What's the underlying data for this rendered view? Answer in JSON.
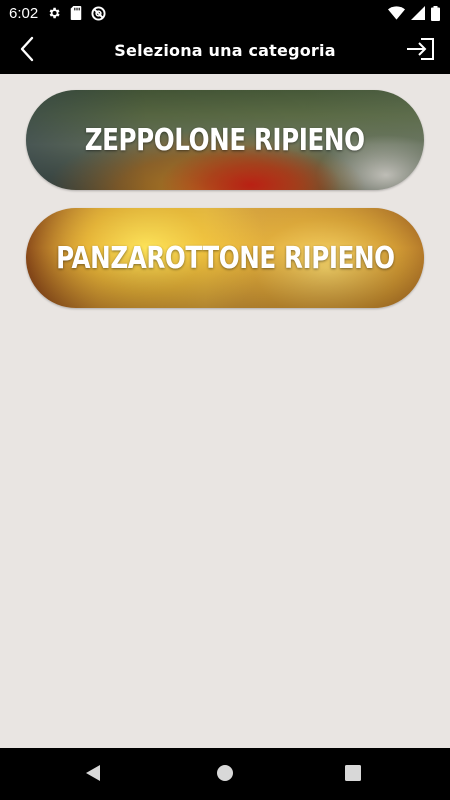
{
  "status_bar": {
    "time": "6:02",
    "icons_left": [
      "gear-icon",
      "sd-card-icon",
      "data-saver-icon"
    ],
    "icons_right": [
      "wifi-icon",
      "signal-icon",
      "battery-icon"
    ]
  },
  "app_bar": {
    "title": "Seleziona una categoria",
    "back_icon": "chevron-left-icon",
    "exit_icon": "login-arrow-icon"
  },
  "categories": [
    {
      "label": "ZEPPOLONE RIPIENO"
    },
    {
      "label": "PANZAROTTONE RIPIENO"
    }
  ],
  "nav_bar": {
    "buttons": [
      "back-triangle-icon",
      "home-circle-icon",
      "recents-square-icon"
    ]
  },
  "colors": {
    "background": "#e9e5e2",
    "bars": "#000000",
    "text_on_dark": "#ffffff"
  }
}
